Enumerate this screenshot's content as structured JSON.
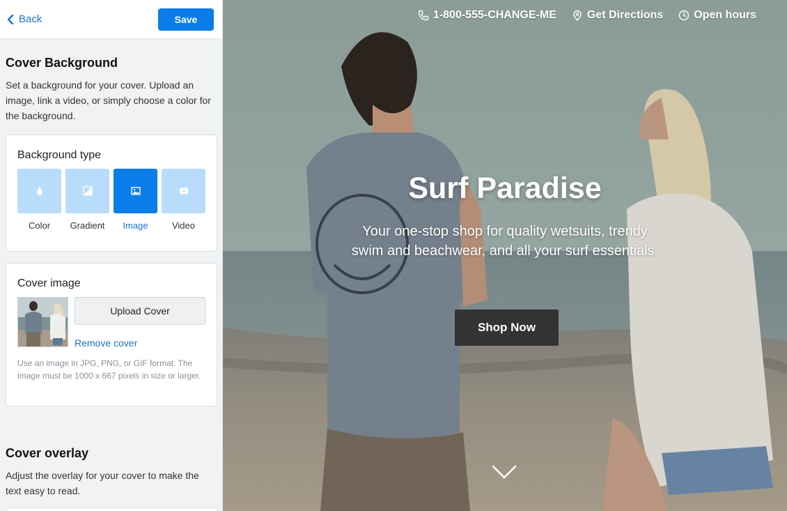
{
  "topbar": {
    "back_label": "Back",
    "save_label": "Save"
  },
  "cover_background": {
    "title": "Cover Background",
    "description": "Set a background for your cover. Upload an image, link a video, or simply choose a color for the background.",
    "background_type": {
      "title": "Background type",
      "options": [
        {
          "label": "Color",
          "icon": "droplet-icon",
          "active": false
        },
        {
          "label": "Gradient",
          "icon": "gradient-icon",
          "active": false
        },
        {
          "label": "Image",
          "icon": "image-icon",
          "active": true
        },
        {
          "label": "Video",
          "icon": "video-icon",
          "active": false
        }
      ]
    },
    "cover_image": {
      "title": "Cover image",
      "upload_label": "Upload Cover",
      "remove_label": "Remove cover",
      "hint": "Use an image in JPG, PNG, or GIF format. The image must be 1000 x 667 pixels in size or larger."
    }
  },
  "cover_overlay": {
    "title": "Cover overlay",
    "description": "Adjust the overlay for your cover to make the text easy to read."
  },
  "preview": {
    "nav": [
      {
        "label": "1-800-555-CHANGE-ME",
        "icon": "phone-icon"
      },
      {
        "label": "Get Directions",
        "icon": "map-pin-icon"
      },
      {
        "label": "Open hours",
        "icon": "clock-icon"
      }
    ],
    "hero": {
      "title": "Surf Paradise",
      "subtitle": "Your one-stop shop for quality wetsuits, trendy swim and beachwear, and all your surf essentials.",
      "button_label": "Shop Now"
    }
  },
  "colors": {
    "accent": "#0a7de8",
    "tile_inactive": "#b9dcfb",
    "shop_button": "#333333"
  }
}
